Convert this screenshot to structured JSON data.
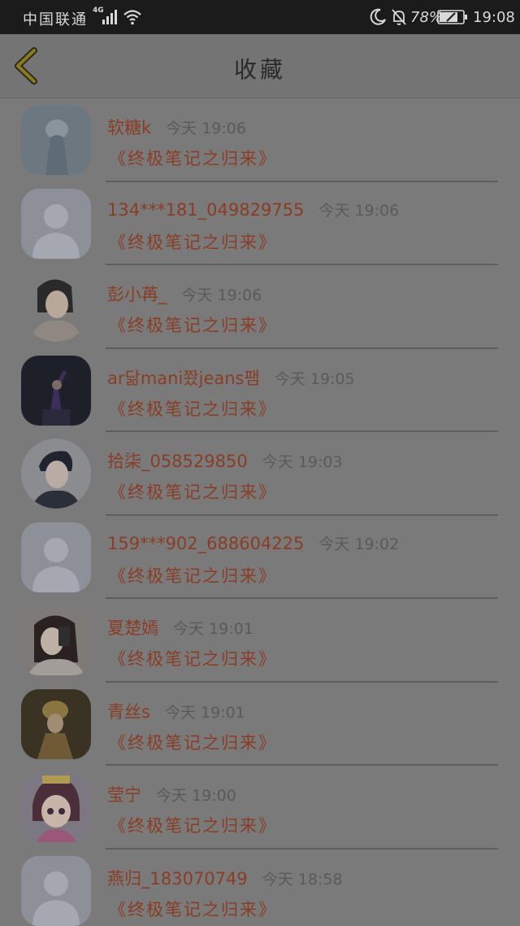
{
  "status_bar": {
    "carrier": "中国联通",
    "network": "4G",
    "battery": "78%",
    "time": "19:08"
  },
  "header": {
    "title": "收藏"
  },
  "favorites": [
    {
      "name": "软糖k",
      "time": "今天 19:06",
      "book": "《终极笔记之归来》",
      "avatar": "photo-misty",
      "shape": "rounded"
    },
    {
      "name": "134***181_049829755",
      "time": "今天 19:06",
      "book": "《终极笔记之归来》",
      "avatar": "default",
      "shape": "rounded"
    },
    {
      "name": "彭小苒_",
      "time": "今天 19:06",
      "book": "《终极笔记之归来》",
      "avatar": "photo-woman",
      "shape": "circle"
    },
    {
      "name": "ar닮mani쫬jeans팸",
      "time": "今天 19:05",
      "book": "《终极笔记之归来》",
      "avatar": "photo-dancer",
      "shape": "rounded"
    },
    {
      "name": "拾柒_058529850",
      "time": "今天 19:03",
      "book": "《终极笔记之归来》",
      "avatar": "photo-boy",
      "shape": "circle"
    },
    {
      "name": "159***902_688604225",
      "time": "今天 19:02",
      "book": "《终极笔记之归来》",
      "avatar": "default",
      "shape": "rounded"
    },
    {
      "name": "夏楚嫣",
      "time": "今天 19:01",
      "book": "《终极笔记之归来》",
      "avatar": "photo-selfie",
      "shape": "rounded"
    },
    {
      "name": "青丝s",
      "time": "今天 19:01",
      "book": "《终极笔记之归来》",
      "avatar": "photo-golden",
      "shape": "rounded"
    },
    {
      "name": "莹宁",
      "time": "今天 19:00",
      "book": "《终极笔记之归来》",
      "avatar": "photo-anime",
      "shape": "rounded"
    },
    {
      "name": "燕归_183070749",
      "time": "今天 18:58",
      "book": "《终极笔记之归来》",
      "avatar": "default",
      "shape": "rounded"
    }
  ]
}
